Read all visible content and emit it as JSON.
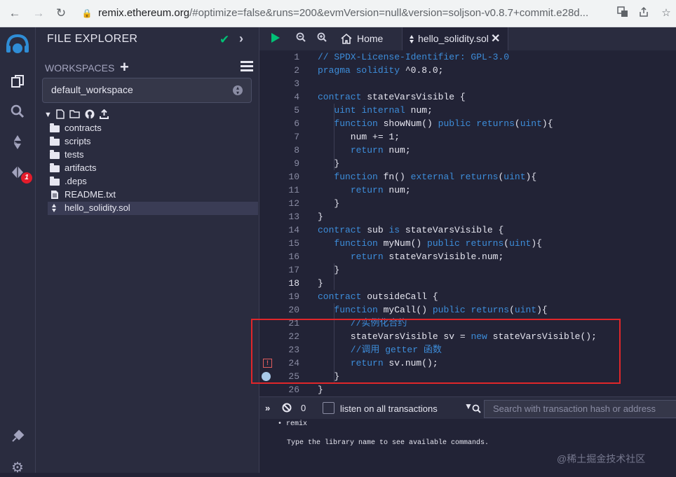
{
  "browser": {
    "url_host": "remix.ethereum.org",
    "url_rest": "/#optimize=false&runs=200&evmVersion=null&version=soljson-v0.8.7+commit.e28d...",
    "back_icon": "←",
    "forward_icon": "→",
    "reload_icon": "↻",
    "lock_icon": "🔒"
  },
  "iconbar": {
    "badge": "1"
  },
  "file_explorer": {
    "title": "FILE EXPLORER",
    "workspaces_label": "WORKSPACES",
    "workspace_selected": "default_workspace",
    "items": [
      {
        "label": "contracts",
        "type": "folder"
      },
      {
        "label": "scripts",
        "type": "folder"
      },
      {
        "label": "tests",
        "type": "folder"
      },
      {
        "label": "artifacts",
        "type": "folder"
      },
      {
        "label": ".deps",
        "type": "folder"
      },
      {
        "label": "README.txt",
        "type": "file"
      },
      {
        "label": "hello_solidity.sol",
        "type": "sol",
        "selected": true
      }
    ]
  },
  "tabs": {
    "home": "Home",
    "file": "hello_solidity.sol"
  },
  "editor": {
    "current_line": 18,
    "lines": [
      {
        "n": "1",
        "code": "// SPDX-License-Identifier: GPL-3.0"
      },
      {
        "n": "2",
        "code": "pragma solidity ^0.8.0;"
      },
      {
        "n": "3",
        "code": ""
      },
      {
        "n": "4",
        "code": "contract stateVarsVisible {"
      },
      {
        "n": "5",
        "code": "   uint internal num;"
      },
      {
        "n": "6",
        "code": "   function showNum() public returns(uint){"
      },
      {
        "n": "7",
        "code": "      num += 1;"
      },
      {
        "n": "8",
        "code": "      return num;"
      },
      {
        "n": "9",
        "code": "   }"
      },
      {
        "n": "10",
        "code": "   function fn() external returns(uint){"
      },
      {
        "n": "11",
        "code": "      return num;"
      },
      {
        "n": "12",
        "code": "   }"
      },
      {
        "n": "13",
        "code": "}"
      },
      {
        "n": "14",
        "code": "contract sub is stateVarsVisible {"
      },
      {
        "n": "15",
        "code": "   function myNum() public returns(uint){"
      },
      {
        "n": "16",
        "code": "      return stateVarsVisible.num;"
      },
      {
        "n": "17",
        "code": "   }"
      },
      {
        "n": "18",
        "code": "}"
      },
      {
        "n": "19",
        "code": "contract outsideCall {"
      },
      {
        "n": "20",
        "code": "   function myCall() public returns(uint){"
      },
      {
        "n": "21",
        "code": "      //实例化合约"
      },
      {
        "n": "22",
        "code": "      stateVarsVisible sv = new stateVarsVisible();"
      },
      {
        "n": "23",
        "code": "      //调用 getter 函数"
      },
      {
        "n": "24",
        "code": "      return sv.num();"
      },
      {
        "n": "25",
        "code": "   }"
      },
      {
        "n": "26",
        "code": "}"
      }
    ]
  },
  "terminal": {
    "count": "0",
    "listen_label": "listen on all transactions",
    "search_placeholder": "Search with transaction hash or address",
    "line1": "• remix",
    "line2": "Type the library name to see available commands.",
    "watermark": "@稀土掘金技术社区"
  },
  "colors": {
    "keyword": "#3d8dda",
    "check": "#00c176",
    "highlight_box": "#e0262a",
    "badge": "#e31c2b"
  }
}
